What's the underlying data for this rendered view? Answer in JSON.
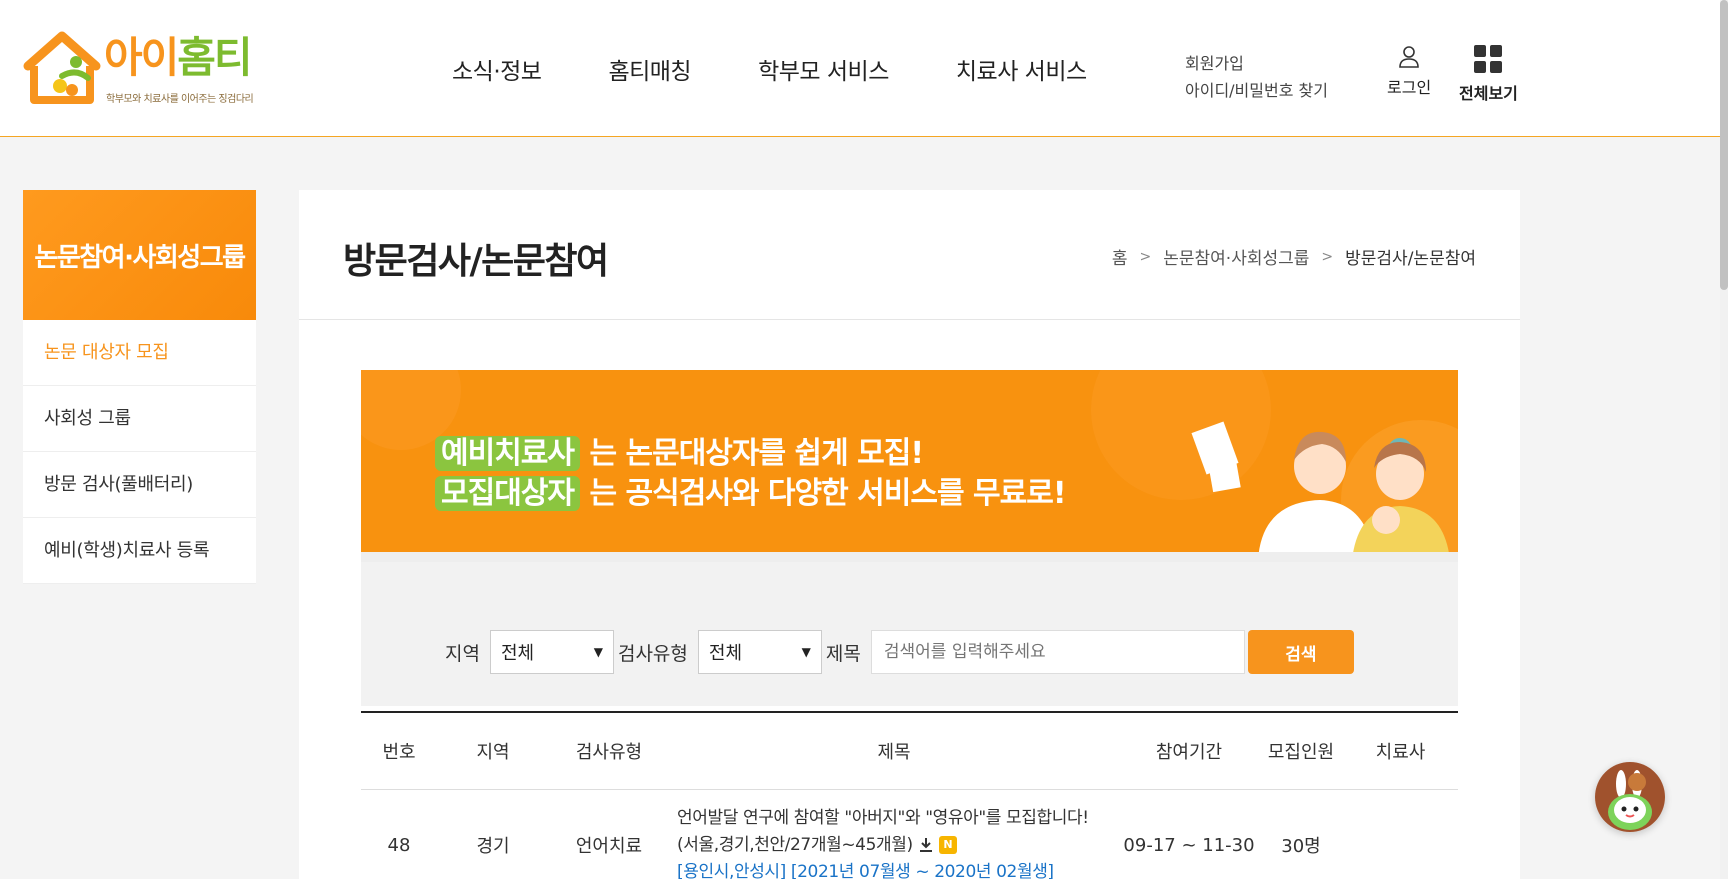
{
  "header": {
    "logo_text_a": "아이",
    "logo_text_b": "홈티",
    "logo_sub": "학부모와 치료사를 이어주는 징검다리",
    "nav": [
      "소식·정보",
      "홈티매칭",
      "학부모 서비스",
      "치료사 서비스"
    ],
    "signup": "회원가입",
    "find_account": "아이디/비밀번호 찾기",
    "login": "로그인",
    "view_all": "전체보기"
  },
  "sidebar": {
    "title": "논문참여·사회성그룹",
    "items": [
      "논문 대상자 모집",
      "사회성 그룹",
      "방문 검사(풀배터리)",
      "예비(학생)치료사 등록"
    ]
  },
  "page": {
    "title": "방문검사/논문참여",
    "breadcrumb": [
      "홈",
      "논문참여·사회성그룹",
      "방문검사/논문참여"
    ]
  },
  "banner": {
    "hl1": "예비치료사",
    "line1": " 는 논문대상자를 쉽게 모집!",
    "hl2": "모집대상자",
    "line2": " 는 공식검사와 다양한 서비스를 무료로!"
  },
  "search": {
    "region_label": "지역",
    "region_value": "전체",
    "type_label": "검사유형",
    "type_value": "전체",
    "title_label": "제목",
    "placeholder": "검색어를 입력해주세요",
    "button": "검색"
  },
  "table": {
    "headers": [
      "번호",
      "지역",
      "검사유형",
      "제목",
      "참여기간",
      "모집인원",
      "치료사"
    ],
    "rows": [
      {
        "no": "48",
        "region": "경기",
        "type": "언어치료",
        "title_line1": "언어발달 연구에 참여할 \"아버지\"와 \"영유아\"를 모집합니다!",
        "title_line2": "(서울,경기,천안/27개월~45개월)",
        "title_tag": "[용인시,안성시] [2021년 07월생 ~ 2020년 02월생]",
        "badge": "N",
        "period": "09-17 ~ 11-30",
        "count": "30명",
        "therapist": ""
      }
    ]
  },
  "colors": {
    "accent": "#f7941d",
    "green": "#8bc53f"
  }
}
